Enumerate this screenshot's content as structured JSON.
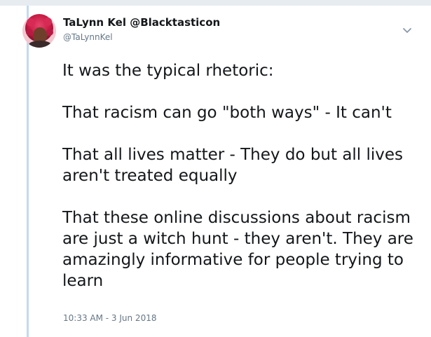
{
  "tweet": {
    "display_name": "TaLynn Kel @Blacktasticon",
    "handle": "@TaLynnKel",
    "paragraphs": [
      "It was the typical rhetoric:",
      "That racism can go \"both ways\" - It can't",
      "That all lives matter - They do but all lives aren't treated equally",
      "That these online discussions about racism are just a witch hunt - they aren't. They are amazingly informative for people trying to learn"
    ],
    "timestamp": "10:33 AM - 3 Jun 2018"
  },
  "icons": {
    "menu": "chevron-down-icon",
    "avatar": "profile-photo"
  },
  "colors": {
    "text": "#14171a",
    "secondary": "#657786",
    "thread_line": "#c4d9ef",
    "divider": "#e6ecf0"
  }
}
